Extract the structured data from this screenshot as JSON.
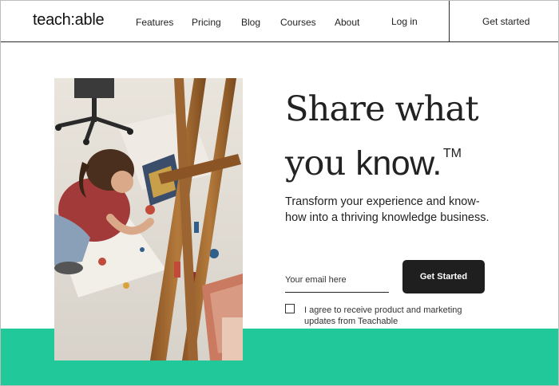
{
  "header": {
    "logo": "teach:able",
    "nav": [
      "Features",
      "Pricing",
      "Blog",
      "Courses",
      "About"
    ],
    "login": "Log in",
    "get_started": "Get started"
  },
  "hero": {
    "headline_line1": "Share what",
    "headline_line2_a": "you ",
    "headline_line2_b": "know.",
    "trademark": "TM",
    "subtext": "Transform your experience and know-how into a thriving knowledge business.",
    "email_placeholder": "Your email here",
    "cta_label": "Get Started",
    "consent_text": "I agree to receive product and marketing updates from Teachable"
  },
  "colors": {
    "accent_green": "#21c99a",
    "button_dark": "#1f1f1f"
  }
}
